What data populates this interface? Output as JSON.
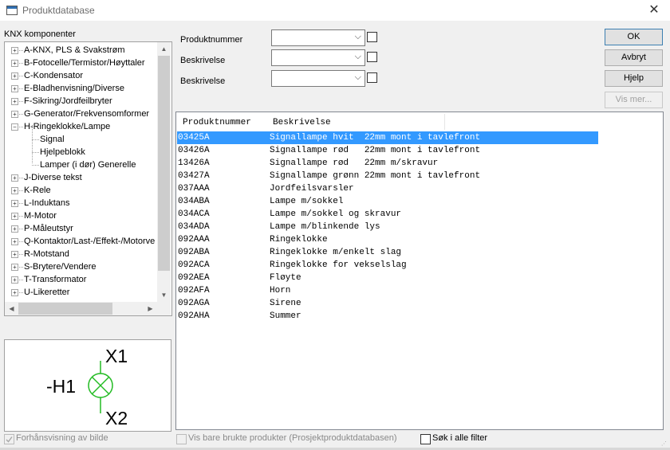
{
  "window": {
    "title": "Produktdatabase",
    "close_glyph": "✕"
  },
  "tree": {
    "label": "KNX komponenter",
    "items": [
      {
        "text": "A-KNX, PLS & Svakstrøm",
        "toggle": "+"
      },
      {
        "text": "B-Fotocelle/Termistor/Høyttaler",
        "toggle": "+"
      },
      {
        "text": "C-Kondensator",
        "toggle": "+"
      },
      {
        "text": "E-Bladhenvisning/Diverse",
        "toggle": "+"
      },
      {
        "text": "F-Sikring/Jordfeilbryter",
        "toggle": "+"
      },
      {
        "text": "G-Generator/Frekvensomformer",
        "toggle": "+"
      },
      {
        "text": "H-Ringeklokke/Lampe",
        "toggle": "−"
      },
      {
        "text": "Signal",
        "toggle": ""
      },
      {
        "text": "Hjelpeblokk",
        "toggle": ""
      },
      {
        "text": "Lamper (i dør) Generelle",
        "toggle": ""
      },
      {
        "text": "J-Diverse tekst",
        "toggle": "+"
      },
      {
        "text": "K-Rele",
        "toggle": "+"
      },
      {
        "text": "L-Induktans",
        "toggle": "+"
      },
      {
        "text": "M-Motor",
        "toggle": "+"
      },
      {
        "text": "P-Måleutstyr",
        "toggle": "+"
      },
      {
        "text": "Q-Kontaktor/Last-/Effekt-/Motorve",
        "toggle": "+"
      },
      {
        "text": "R-Motstand",
        "toggle": "+"
      },
      {
        "text": "S-Brytere/Vendere",
        "toggle": "+"
      },
      {
        "text": "T-Transformator",
        "toggle": "+"
      },
      {
        "text": "U-Likeretter",
        "toggle": "+"
      }
    ]
  },
  "preview": {
    "symbol_designation": "-H1",
    "terminal_top": "X1",
    "terminal_bottom": "X2",
    "toggle_label": "Forhånsvisning av bilde",
    "toggle_checked": true
  },
  "filters": [
    {
      "label": "Produktnummer",
      "value": ""
    },
    {
      "label": "Beskrivelse",
      "value": ""
    },
    {
      "label": "Beskrivelse",
      "value": ""
    }
  ],
  "buttons": {
    "ok": "OK",
    "cancel": "Avbryt",
    "help": "Hjelp",
    "show_more": "Vis mer..."
  },
  "list": {
    "columns": [
      "Produktnummer",
      "Beskrivelse"
    ],
    "selected_index": 0,
    "rows": [
      [
        "03425A",
        "Signallampe hvit  22mm mont i tavlefront"
      ],
      [
        "03426A",
        "Signallampe rød   22mm mont i tavlefront"
      ],
      [
        "13426A",
        "Signallampe rød   22mm m/skravur"
      ],
      [
        "03427A",
        "Signallampe grønn 22mm mont i tavlefront"
      ],
      [
        "037AAA",
        "Jordfeilsvarsler"
      ],
      [
        "034ABA",
        "Lampe m/sokkel"
      ],
      [
        "034ACA",
        "Lampe m/sokkel og skravur"
      ],
      [
        "034ADA",
        "Lampe m/blinkende lys"
      ],
      [
        "092AAA",
        "Ringeklokke"
      ],
      [
        "092ABA",
        "Ringeklokke m/enkelt slag"
      ],
      [
        "092ACA",
        "Ringeklokke for vekselslag"
      ],
      [
        "092AEA",
        "Fløyte"
      ],
      [
        "092AFA",
        "Horn"
      ],
      [
        "092AGA",
        "Sirene"
      ],
      [
        "092AHA",
        "Summer"
      ]
    ]
  },
  "footer": {
    "used_only_label": "Vis bare brukte produkter (Prosjektproduktdatabasen)",
    "used_only_checked": false,
    "search_all_label": "Søk i alle filter",
    "search_all_checked": false
  },
  "colors": {
    "selection": "#3399ff",
    "symbol_green": "#22bb22"
  }
}
